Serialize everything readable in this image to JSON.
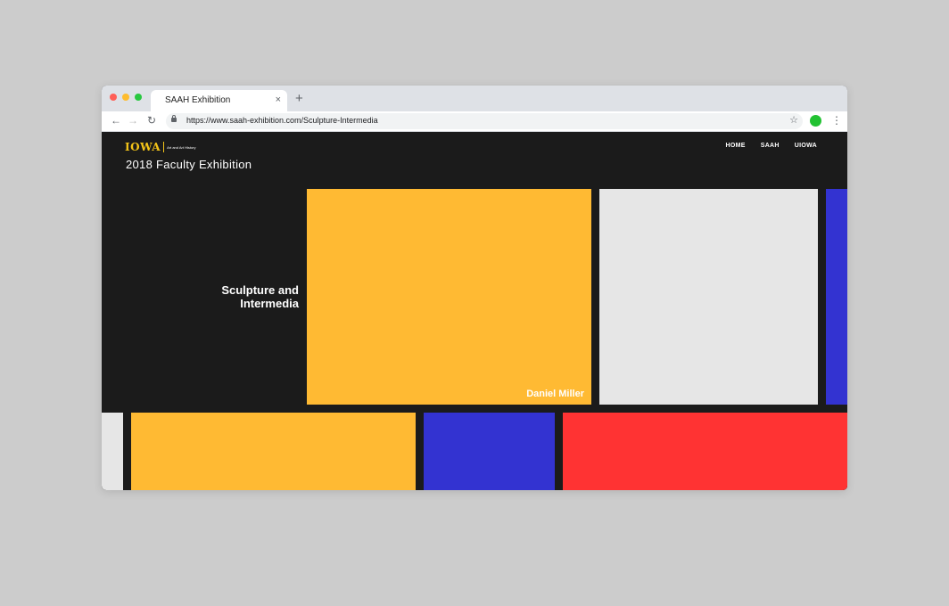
{
  "browser": {
    "tab_title": "SAAH Exhibition",
    "tab_close": "×",
    "new_tab": "+",
    "url": "https://www.saah-exhibition.com/Sculpture-Intermedia",
    "back_glyph": "←",
    "forward_glyph": "→",
    "reload_glyph": "↻",
    "star_glyph": "☆",
    "menu_glyph": "⋮"
  },
  "site": {
    "logo": "IOWA",
    "logo_sub": "Art and Art History",
    "title": "2018 Faculty Exhibition",
    "nav": [
      "HOME",
      "SAAH",
      "UIOWA"
    ]
  },
  "section": {
    "title": "Sculpture and Intermedia"
  },
  "tiles": {
    "featured_artist": "Daniel Miller"
  },
  "colors": {
    "background": "#1b1b1b",
    "yellow": "#ffba33",
    "gray": "#e6e6e6",
    "blue": "#3333d1",
    "red": "#ff3333",
    "brand_gold": "#f5c518"
  }
}
